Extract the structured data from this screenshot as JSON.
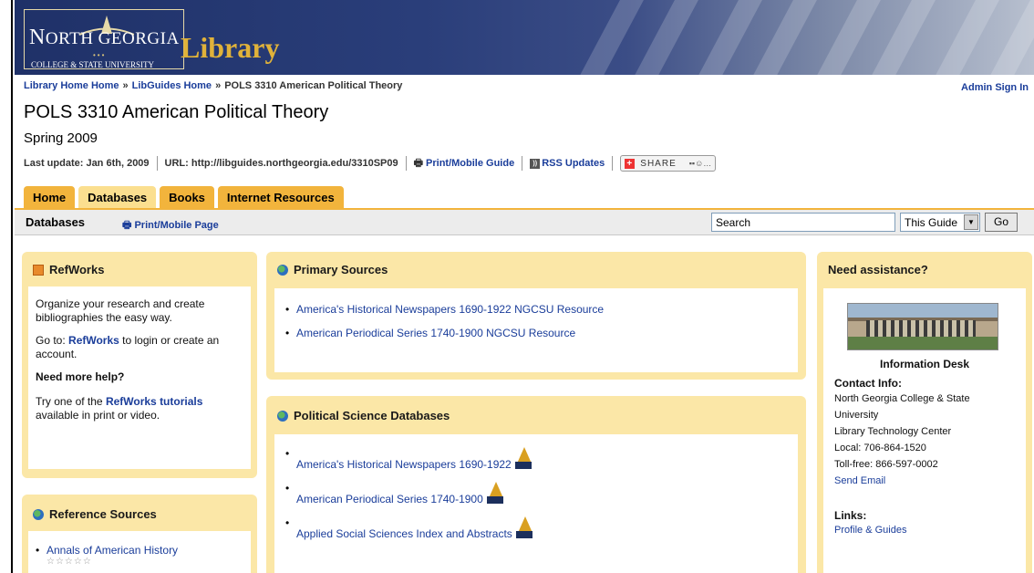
{
  "banner": {
    "logo_name_big": "N",
    "logo_name_rest": "ORTH GEORGIA",
    "logo_sub": "COLLEGE & STATE UNIVERSITY",
    "library": "Library"
  },
  "breadcrumb": {
    "home": "Library Home Home",
    "sep1": "»",
    "libguides": "LibGuides Home",
    "sep2": "»",
    "current": "POLS 3310 American Political Theory"
  },
  "admin_signin": "Admin Sign In",
  "guide": {
    "title": "POLS 3310 American Political Theory",
    "semester": "Spring 2009",
    "last_update": "Last update: Jan 6th, 2009",
    "url": "URL: http://libguides.northgeorgia.edu/3310SP09",
    "print_guide": "Print/Mobile Guide",
    "rss": "RSS Updates",
    "share": "SHARE"
  },
  "tabs": [
    {
      "label": "Home"
    },
    {
      "label": "Databases"
    },
    {
      "label": "Books"
    },
    {
      "label": "Internet Resources"
    }
  ],
  "subbar": {
    "title": "Databases",
    "print_page": "Print/Mobile Page",
    "search_value": "Search",
    "scope_value": "This Guide",
    "go": "Go"
  },
  "refworks": {
    "title": "RefWorks",
    "intro": "Organize your research and create bibliographies the easy way.",
    "goto_pre": "Go to: ",
    "goto_link": "RefWorks",
    "goto_post": " to login or create an account.",
    "help_head": "Need more help?",
    "try_pre": "Try one of the ",
    "try_link": "RefWorks tutorials",
    "try_post": " available in print or video."
  },
  "reference": {
    "title": "Reference Sources",
    "items": [
      {
        "label": "Annals of American History"
      }
    ],
    "stars": "☆☆☆☆☆"
  },
  "primary": {
    "title": "Primary Sources",
    "items": [
      {
        "label": "America's Historical Newspapers 1690-1922 NGCSU Resource"
      },
      {
        "label": "American Periodical Series 1740-1900 NGCSU Resource"
      }
    ]
  },
  "polisci": {
    "title": "Political Science Databases",
    "items": [
      {
        "label": "America's Historical Newspapers 1690-1922"
      },
      {
        "label": "American Periodical Series 1740-1900"
      },
      {
        "label": "Applied Social Sciences Index and Abstracts"
      }
    ]
  },
  "assist": {
    "title": "Need assistance?",
    "photo_caption": "Information Desk",
    "contact_head": "Contact Info:",
    "contact_lines": [
      "North Georgia College & State",
      "University",
      "Library Technology Center",
      "Local: 706-864-1520",
      "Toll-free: 866-597-0002"
    ],
    "email": "Send Email",
    "links_head": "Links:",
    "profile": "Profile & Guides"
  }
}
